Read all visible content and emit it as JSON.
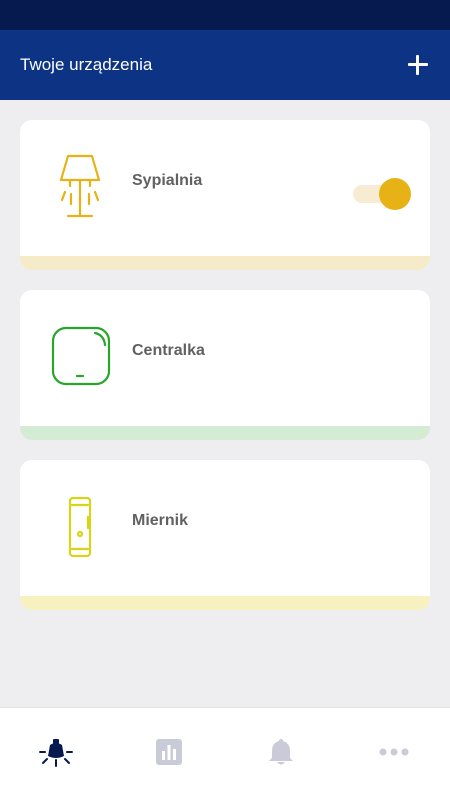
{
  "header": {
    "title": "Twoje urządzenia",
    "add_icon": "plus-icon"
  },
  "devices": [
    {
      "name": "Sypialnia",
      "icon": "lamp-icon",
      "color": "#e7b216",
      "bar_color": "#f6ebc8",
      "has_toggle": true,
      "toggle_on": true
    },
    {
      "name": "Centralka",
      "icon": "hub-icon",
      "color": "#2aa52b",
      "bar_color": "#d4ebd4",
      "has_toggle": false
    },
    {
      "name": "Miernik",
      "icon": "meter-icon",
      "color": "#d8d41a",
      "bar_color": "#f7f1c0",
      "has_toggle": false
    }
  ],
  "bottom_nav": [
    {
      "icon": "bulb-icon",
      "active": true,
      "color": "#061a4f"
    },
    {
      "icon": "chart-icon",
      "active": false,
      "color": "#c9ccd8"
    },
    {
      "icon": "bell-icon",
      "active": false,
      "color": "#c9ccd8"
    },
    {
      "icon": "more-icon",
      "active": false,
      "color": "#c9ccd8"
    }
  ]
}
